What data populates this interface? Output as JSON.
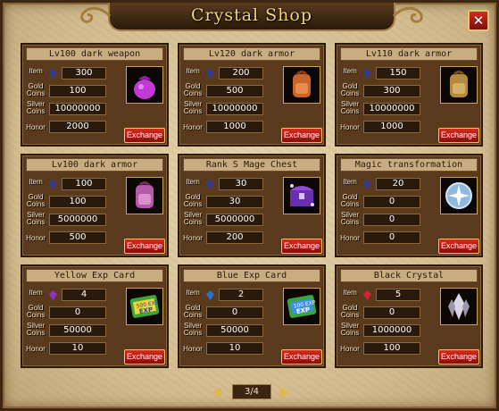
{
  "window": {
    "title": "Crystal Shop",
    "close_label": "✕"
  },
  "labels": {
    "item": "Item",
    "gold": "Gold Coins",
    "silver": "Silver Coins",
    "honor": "Honor",
    "exchange": "Exchange"
  },
  "cards": [
    {
      "name": "Lv100 dark weapon",
      "item": "300",
      "gold": "100",
      "silver": "10000000",
      "honor": "2000",
      "gem_color": "#2d3a8f",
      "icon": "purple-bag-icon"
    },
    {
      "name": "Lv120 dark armor",
      "item": "200",
      "gold": "500",
      "silver": "10000000",
      "honor": "1000",
      "gem_color": "#2d3a8f",
      "icon": "orange-backpack-icon"
    },
    {
      "name": "Lv110 dark armor",
      "item": "150",
      "gold": "300",
      "silver": "10000000",
      "honor": "1000",
      "gem_color": "#2d3a8f",
      "icon": "tan-backpack-icon"
    },
    {
      "name": "Lv100 dark armor",
      "item": "100",
      "gold": "100",
      "silver": "5000000",
      "honor": "500",
      "gem_color": "#2d3a8f",
      "icon": "pink-backpack-icon"
    },
    {
      "name": "Rank S Mage Chest",
      "item": "30",
      "gold": "30",
      "silver": "5000000",
      "honor": "200",
      "gem_color": "#2d3a8f",
      "icon": "purple-chest-icon"
    },
    {
      "name": "Magic transformation",
      "item": "20",
      "gold": "0",
      "silver": "0",
      "honor": "0",
      "gem_color": "#2d3a8f",
      "icon": "compass-icon"
    },
    {
      "name": "Yellow Exp Card",
      "item": "4",
      "gold": "0",
      "silver": "50000",
      "honor": "10",
      "gem_color": "#8a34c8",
      "icon": "yellow-exp-card-icon"
    },
    {
      "name": "Blue Exp Card",
      "item": "2",
      "gold": "0",
      "silver": "50000",
      "honor": "10",
      "gem_color": "#2e6fd1",
      "icon": "blue-exp-card-icon"
    },
    {
      "name": "Black Crystal",
      "item": "5",
      "gold": "0",
      "silver": "1000000",
      "honor": "100",
      "gem_color": "#d2233a",
      "icon": "black-crystal-icon"
    }
  ],
  "icon_text": {
    "yellow_card": "500 EXP",
    "blue_card": "100 EXP"
  },
  "pagination": {
    "page": "3/4"
  }
}
